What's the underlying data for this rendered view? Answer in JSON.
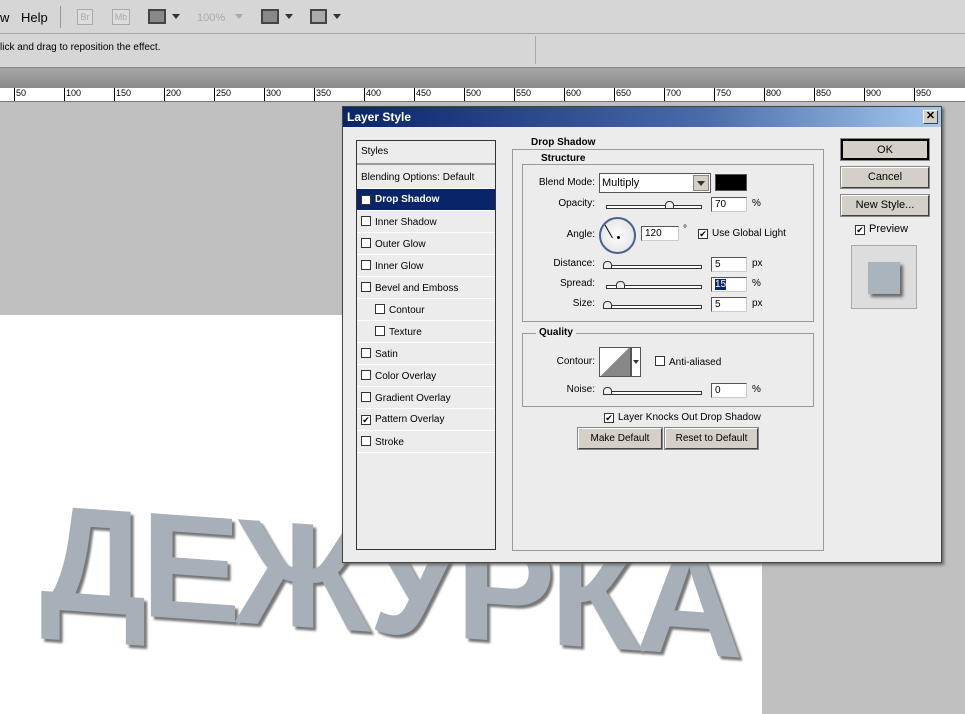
{
  "menu": {
    "view_partial": "w",
    "help": "Help",
    "br": "Br",
    "mb": "Mb",
    "zoom": "100%"
  },
  "options": {
    "hint": "lick and drag to reposition the effect."
  },
  "ruler": [
    "50",
    "100",
    "150",
    "200",
    "250",
    "300",
    "350",
    "400",
    "450",
    "500",
    "550",
    "600",
    "650",
    "700",
    "750",
    "800",
    "850",
    "900",
    "950"
  ],
  "canvas": {
    "text": "ДЕЖУРКА"
  },
  "dialog": {
    "title": "Layer Style",
    "close": "✕",
    "styles_header": "Styles",
    "blending": "Blending Options: Default",
    "items": [
      {
        "label": "Drop Shadow",
        "checked": true,
        "selected": true,
        "indent": false
      },
      {
        "label": "Inner Shadow",
        "checked": false,
        "indent": false
      },
      {
        "label": "Outer Glow",
        "checked": false,
        "indent": false
      },
      {
        "label": "Inner Glow",
        "checked": false,
        "indent": false
      },
      {
        "label": "Bevel and Emboss",
        "checked": false,
        "indent": false
      },
      {
        "label": "Contour",
        "checked": false,
        "indent": true
      },
      {
        "label": "Texture",
        "checked": false,
        "indent": true
      },
      {
        "label": "Satin",
        "checked": false,
        "indent": false
      },
      {
        "label": "Color Overlay",
        "checked": false,
        "indent": false
      },
      {
        "label": "Gradient Overlay",
        "checked": false,
        "indent": false
      },
      {
        "label": "Pattern Overlay",
        "checked": true,
        "indent": false
      },
      {
        "label": "Stroke",
        "checked": false,
        "indent": false
      }
    ],
    "section": "Drop Shadow",
    "structure": "Structure",
    "blend_label": "Blend Mode:",
    "blend_value": "Multiply",
    "shadow_color": "#000000",
    "opacity_label": "Opacity:",
    "opacity": "70",
    "opacity_unit": "%",
    "opacity_pct": 70,
    "angle_label": "Angle:",
    "angle": "120",
    "angle_unit": "°",
    "global_light": "Use Global Light",
    "distance_label": "Distance:",
    "distance": "5",
    "distance_unit": "px",
    "distance_pct": 0,
    "spread_label": "Spread:",
    "spread": "15",
    "spread_unit": "%",
    "spread_pct": 15,
    "size_label": "Size:",
    "size": "5",
    "size_unit": "px",
    "size_pct": 0,
    "quality": "Quality",
    "contour_label": "Contour:",
    "anti_aliased": "Anti-aliased",
    "noise_label": "Noise:",
    "noise": "0",
    "noise_unit": "%",
    "noise_pct": 0,
    "knockout": "Layer Knocks Out Drop Shadow",
    "make_default": "Make Default",
    "reset_default": "Reset to Default",
    "ok": "OK",
    "cancel": "Cancel",
    "new_style": "New Style...",
    "preview": "Preview"
  }
}
